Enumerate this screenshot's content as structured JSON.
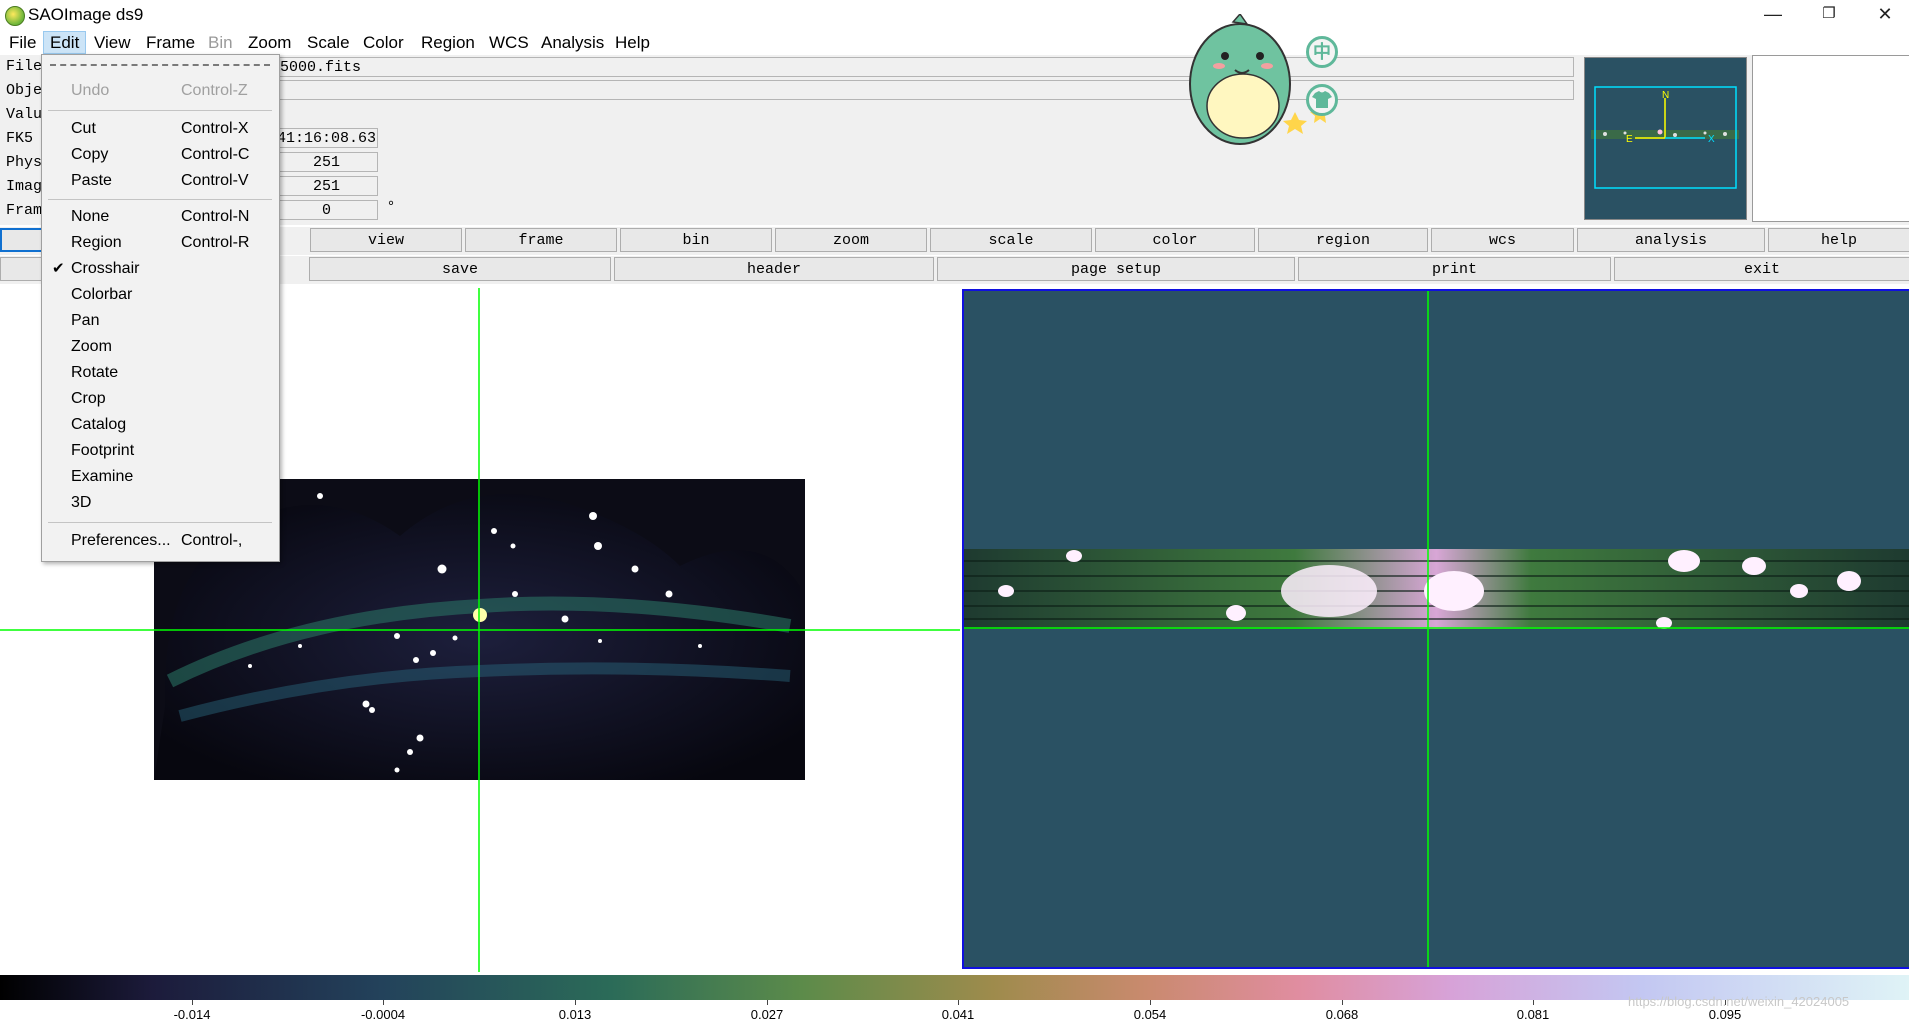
{
  "window": {
    "title": "SAOImage ds9",
    "minimize": "—",
    "restore": "❐",
    "close": "✕"
  },
  "menubar": [
    "File",
    "Edit",
    "View",
    "Frame",
    "Bin",
    "Zoom",
    "Scale",
    "Color",
    "Region",
    "WCS",
    "Analysis",
    "Help"
  ],
  "info": {
    "labels": [
      "File",
      "Obje",
      "Valu",
      "FK5",
      "Phys",
      "Imag",
      "Fram"
    ],
    "file_value": "5000.fits",
    "fk5_value": "41:16:08.63",
    "phys_value": "251",
    "imag_value": "251",
    "frame_value": "0",
    "degree_symbol": "°"
  },
  "buttonbar1": [
    "view",
    "frame",
    "bin",
    "zoom",
    "scale",
    "color",
    "region",
    "wcs",
    "analysis",
    "help"
  ],
  "buttonbar2": [
    "save",
    "header",
    "page setup",
    "print",
    "exit"
  ],
  "edit_menu": {
    "items": [
      {
        "label": "Undo",
        "accel": "Control-Z",
        "disabled": true
      },
      {
        "label": "Cut",
        "accel": "Control-X"
      },
      {
        "label": "Copy",
        "accel": "Control-C"
      },
      {
        "label": "Paste",
        "accel": "Control-V"
      },
      {
        "label": "None",
        "accel": "Control-N"
      },
      {
        "label": "Region",
        "accel": "Control-R"
      },
      {
        "label": "Crosshair",
        "accel": "",
        "checked": true
      },
      {
        "label": "Colorbar",
        "accel": ""
      },
      {
        "label": "Pan",
        "accel": ""
      },
      {
        "label": "Zoom",
        "accel": ""
      },
      {
        "label": "Rotate",
        "accel": ""
      },
      {
        "label": "Crop",
        "accel": ""
      },
      {
        "label": "Catalog",
        "accel": ""
      },
      {
        "label": "Footprint",
        "accel": ""
      },
      {
        "label": "Examine",
        "accel": ""
      },
      {
        "label": "3D",
        "accel": ""
      },
      {
        "label": "Preferences...",
        "accel": "Control-,"
      }
    ],
    "check_glyph": "✔"
  },
  "colorbar": {
    "tick_labels": [
      "-0.014",
      "-0.0004",
      "0.013",
      "0.027",
      "0.041",
      "0.054",
      "0.068",
      "0.081",
      "0.095"
    ]
  },
  "watermark": "https://blog.csdn.net/weixin_42024005",
  "colors": {
    "canvas_bg": "#2a5163",
    "crosshair": "#00ff00",
    "frame_highlight": "#1010e0",
    "menu_active": "#cce4f7"
  },
  "icons": {
    "app": "ds9-icon",
    "overlay": [
      "chinese-input-icon",
      "tshirt-skin-icon"
    ]
  },
  "overlay_text": {
    "ime": "中"
  }
}
